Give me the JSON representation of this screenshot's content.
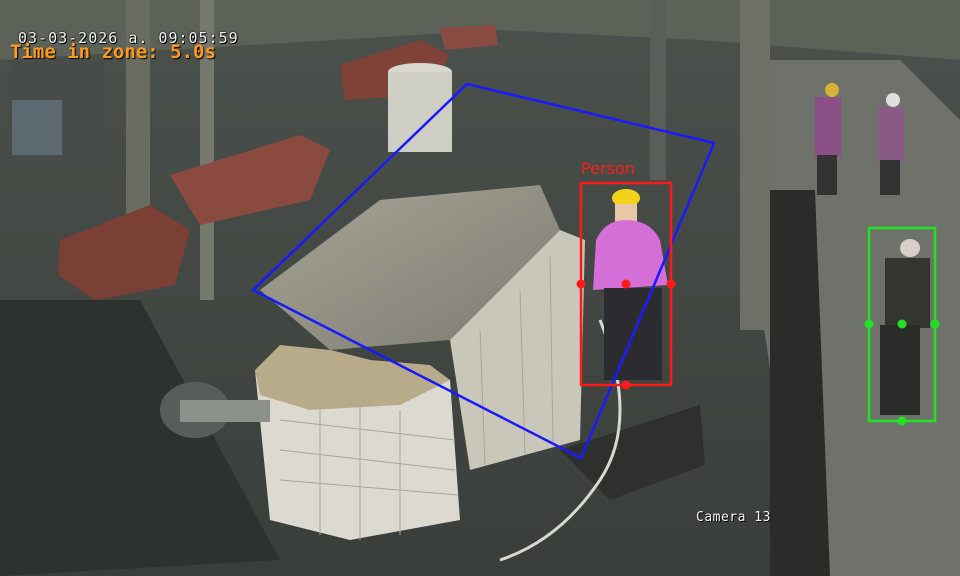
{
  "overlay": {
    "timestamp": "03-03-2026 a.  09:05:59",
    "zone_time": "Time in zone: 5.0s",
    "camera_label": "Camera 13"
  },
  "detections": [
    {
      "label": "Person",
      "status": "in-zone",
      "color": "#ff1a1a",
      "label_shown": true
    },
    {
      "label": "",
      "status": "outside-zone",
      "color": "#22e022",
      "label_shown": false
    }
  ],
  "zone": {
    "color": "#1a1aff"
  }
}
